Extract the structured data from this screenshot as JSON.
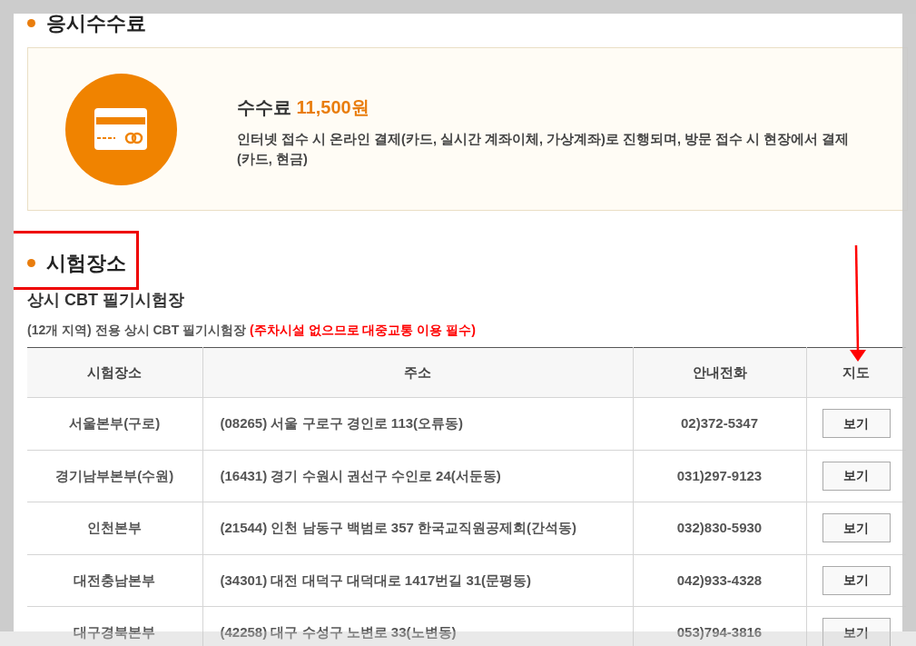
{
  "fee_section": {
    "title": "응시수수료",
    "fee": "수수료 **11,500원**",
    "description": "인터넷 접수 시 온라인 결제(카드, 실시간 계좌이체, 가상계좌)로 진행되며, 방문 접수 시 현장에서 결제 (카드, 현금)"
  },
  "venue_section": {
    "title": "시험장소",
    "subtitle": "상시 CBT 필기시험장",
    "note": "(12개 지역) 전용 상시 CBT 필기시험장 **(주차시설 없으므로 대중교통 이용 필수)**"
  },
  "table": {
    "columns": [
      "시험장소",
      "주소",
      "안내전화",
      "지도"
    ],
    "rows": [
      {
        "venue": "서울본부(구로)",
        "address": "(08265) 서울 구로구 경인로 113(오류동)",
        "phone": "02)372-5347",
        "map_button": "보기"
      },
      {
        "venue": "경기남부본부(수원)",
        "address": "(16431) 경기 수원시 권선구 수인로 24(서둔동)",
        "phone": "031)297-9123",
        "map_button": "보기"
      },
      {
        "venue": "인천본부",
        "address": "(21544) 인천 남동구 백범로 357 한국교직원공제회(간석동)",
        "phone": "032)830-5930",
        "map_button": "보기"
      },
      {
        "venue": "대전충남본부",
        "address": "(34301) 대전 대덕구 대덕대로 1417번길 31(문평동)",
        "phone": "042)933-4328",
        "map_button": "보기"
      },
      {
        "venue": "대구경북본부",
        "address": "(42258) 대구 수성구 노변로 33(노변동)",
        "phone": "053)794-3816",
        "map_button": "보기"
      }
    ]
  }
}
